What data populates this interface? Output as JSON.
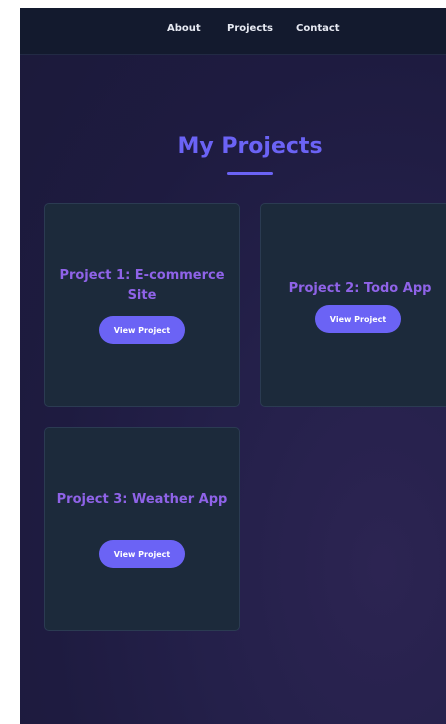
{
  "nav": {
    "items": [
      {
        "label": "About"
      },
      {
        "label": "Projects"
      },
      {
        "label": "Contact"
      }
    ]
  },
  "section": {
    "title": "My Projects"
  },
  "projects": [
    {
      "title": "Project 1: E-commerce Site",
      "button_label": "View Project"
    },
    {
      "title": "Project 2: Todo App",
      "button_label": "View Project"
    },
    {
      "title": "Project 3: Weather App",
      "button_label": "View Project"
    }
  ],
  "colors": {
    "accent": "#6b63f5",
    "card_title": "#8f63e8",
    "card_bg": "#1c2a3b",
    "nav_bg": "#131a2e",
    "page_bg": "#1e1b40"
  }
}
